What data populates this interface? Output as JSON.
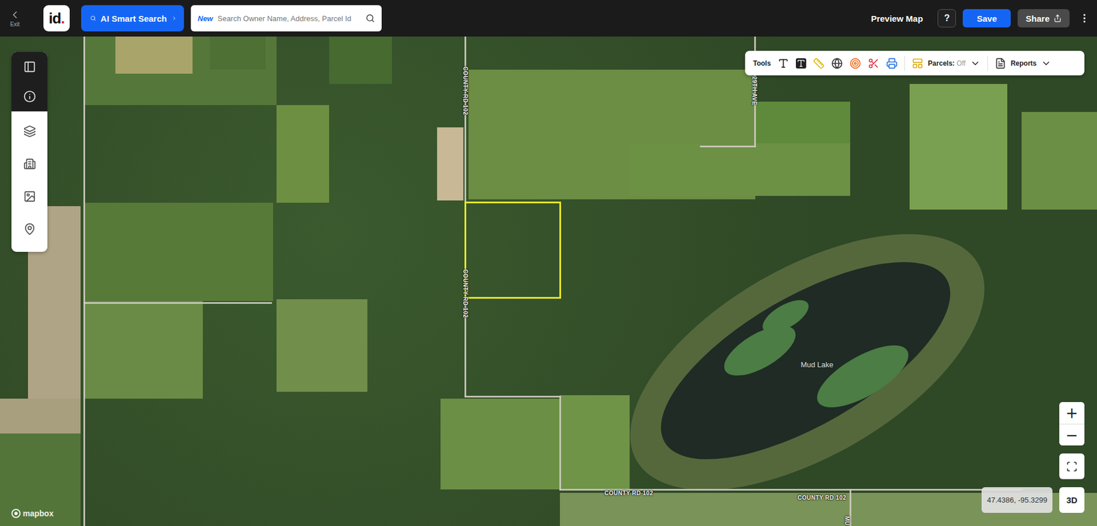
{
  "topbar": {
    "exit": "Exit",
    "logo": {
      "letters": "id",
      "dot": "."
    },
    "ai_search": "AI Smart Search",
    "search": {
      "badge": "New",
      "placeholder": "Search Owner Name, Address, Parcel Id"
    },
    "preview": "Preview Map",
    "help": "?",
    "save": "Save",
    "share": "Share"
  },
  "tools": {
    "label": "Tools",
    "parcels": {
      "label": "Parcels:",
      "value": "Off"
    },
    "reports": "Reports"
  },
  "map": {
    "labels": [
      {
        "text": "COUNTY RD 102",
        "kind": "vertical"
      },
      {
        "text": "COUNTY RD 102",
        "kind": "vertical"
      },
      {
        "text": "COUNTY RD 102",
        "kind": "horizontal"
      },
      {
        "text": "COUNTY RD 102",
        "kind": "horizontal"
      },
      {
        "text": "29TH AVE",
        "kind": "vertical"
      },
      {
        "text": "MU",
        "kind": "vertical"
      }
    ],
    "lake": "Mud Lake",
    "attribution": "mapbox",
    "coordinates": "47.4386, -95.3299",
    "zoom_in": "+",
    "zoom_out": "−",
    "view_3d": "3D"
  }
}
